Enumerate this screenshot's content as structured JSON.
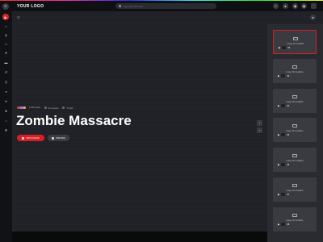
{
  "header": {
    "logo": "YOUR LOGO",
    "search_placeholder": "Type and hit enter ..."
  },
  "hero": {
    "title": "Zombie Massacre",
    "meta_count": "1,354 views",
    "meta_duration": "20 minutes",
    "meta_rating": "TV-MA",
    "watch_label": "WATCH NOW",
    "preview_label": "PREVIEW",
    "pager_prev": "‹",
    "pager_next": "›"
  },
  "playlist": {
    "items": [
      {
        "placeholder": "Image Not Available",
        "episode": "02"
      },
      {
        "placeholder": "Image Not Available",
        "episode": "03"
      },
      {
        "placeholder": "Image Not Available",
        "episode": "04"
      },
      {
        "placeholder": "Image Not Available",
        "episode": "05"
      },
      {
        "placeholder": "Image Not Available",
        "episode": "06"
      },
      {
        "placeholder": "Image Not Available",
        "episode": "07"
      },
      {
        "placeholder": "Image Not Available",
        "episode": "08"
      }
    ]
  },
  "colors": {
    "accent": "#d61f26",
    "bg": "#202126",
    "panel": "#2a2b30"
  },
  "icons": {
    "sidebar": [
      "play-icon",
      "home-icon",
      "compass-icon",
      "fire-icon",
      "heart-icon",
      "folder-icon",
      "history-icon",
      "clock-icon",
      "link-icon",
      "tag-icon",
      "star-icon",
      "music-icon",
      "settings-icon"
    ]
  }
}
